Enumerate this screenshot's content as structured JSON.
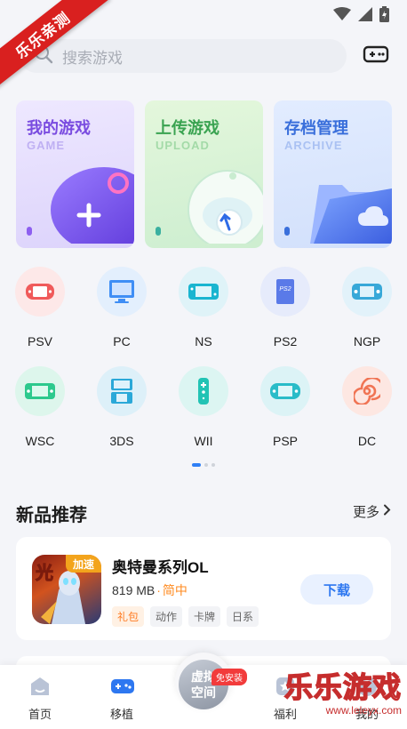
{
  "status_bar": {
    "icons": [
      "wifi-icon",
      "signal-icon",
      "battery-icon"
    ]
  },
  "ribbon": {
    "text": "乐乐亲测"
  },
  "search": {
    "placeholder": "搜索游戏"
  },
  "feature_cards": [
    {
      "title": "我的游戏",
      "subtitle": "GAME",
      "color": "#7a4ce0"
    },
    {
      "title": "上传游戏",
      "subtitle": "UPLOAD",
      "color": "#3aa351"
    },
    {
      "title": "存档管理",
      "subtitle": "ARCHIVE",
      "color": "#3a6fdb"
    }
  ],
  "platforms_row1": [
    {
      "label": "PSV",
      "icon": "psv-console-icon",
      "color": "#f05a5a"
    },
    {
      "label": "PC",
      "icon": "monitor-icon",
      "color": "#3f8ef5"
    },
    {
      "label": "NS",
      "icon": "switch-console-icon",
      "color": "#19b5d0"
    },
    {
      "label": "PS2",
      "icon": "ps2-disc-icon",
      "color": "#5a7ae8"
    },
    {
      "label": "NGP",
      "icon": "ngp-console-icon",
      "color": "#37a8d8"
    }
  ],
  "platforms_row2": [
    {
      "label": "WSC",
      "icon": "wsc-console-icon",
      "color": "#2cc98d"
    },
    {
      "label": "3DS",
      "icon": "3ds-console-icon",
      "color": "#2ba8d8"
    },
    {
      "label": "WII",
      "icon": "wii-remote-icon",
      "color": "#22c3b4"
    },
    {
      "label": "PSP",
      "icon": "psp-console-icon",
      "color": "#29bcc8"
    },
    {
      "label": "DC",
      "icon": "dreamcast-swirl-icon",
      "color": "#f07454"
    }
  ],
  "section": {
    "title": "新品推荐",
    "more": "更多"
  },
  "game": {
    "badge": "加速",
    "icon_text": "光",
    "name": "奥特曼系列OL",
    "size": "819 MB",
    "separator": "·",
    "language": "简中",
    "tags": [
      "礼包",
      "动作",
      "卡牌",
      "日系"
    ],
    "download": "下载"
  },
  "bottom_nav": {
    "items": [
      "首页",
      "移植",
      "福利",
      "我的"
    ],
    "center_line1": "虚拟",
    "center_line2": "空间",
    "center_badge": "免安装"
  },
  "watermark": {
    "main": "乐乐游戏",
    "sub": "www.leleyx.com"
  }
}
